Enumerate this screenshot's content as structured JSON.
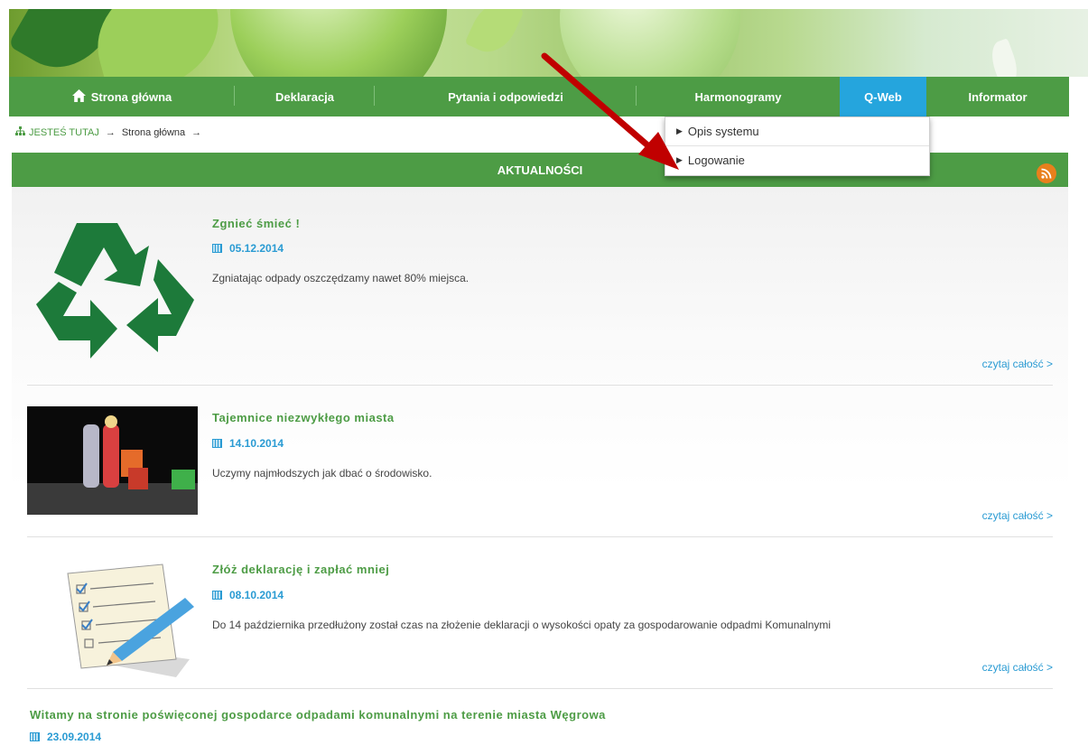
{
  "nav": {
    "items": [
      {
        "label": "Strona główna",
        "icon": "home-icon"
      },
      {
        "label": "Deklaracja"
      },
      {
        "label": "Pytania i odpowiedzi"
      },
      {
        "label": "Harmonogramy"
      },
      {
        "label": "Q-Web",
        "active": true
      },
      {
        "label": "Informator"
      }
    ]
  },
  "dropdown": {
    "items": [
      {
        "label": "Opis systemu"
      },
      {
        "label": "Logowanie"
      }
    ]
  },
  "breadcrumb": {
    "label": "JESTEŚ TUTAJ",
    "items": [
      "Strona główna"
    ]
  },
  "section": {
    "title": "AKTUALNOŚCI",
    "rss_icon": "rss-icon"
  },
  "news": [
    {
      "title": "Zgnieć śmieć !",
      "date": "05.12.2014",
      "description": "Zgniatając odpady oszczędzamy nawet 80% miejsca.",
      "read_more": "czytaj całość >",
      "thumb_icon": "recycle-icon"
    },
    {
      "title": "Tajemnice niezwykłego miasta",
      "date": "14.10.2014",
      "description": "Uczymy najmłodszych jak dbać o środowisko.",
      "read_more": "czytaj całość >",
      "thumb_icon": "theater-photo"
    },
    {
      "title": "Złóż deklarację i zapłać mniej",
      "date": "08.10.2014",
      "description": "Do 14 października przedłużony został czas na złożenie deklaracji o wysokości opaty za gospodarowanie odpadmi Komunalnymi",
      "read_more": "czytaj całość >",
      "thumb_icon": "checklist-pencil-icon"
    },
    {
      "title": "Witamy na stronie poświęconej gospodarce odpadami komunalnymi na terenie miasta Węgrowa",
      "date": "23.09.2014"
    }
  ],
  "colors": {
    "nav_green": "#4d9c45",
    "active_blue": "#25a5dd",
    "link_blue": "#2a9bd3",
    "rss_orange": "#e8801c",
    "arrow_red": "#c00000"
  }
}
